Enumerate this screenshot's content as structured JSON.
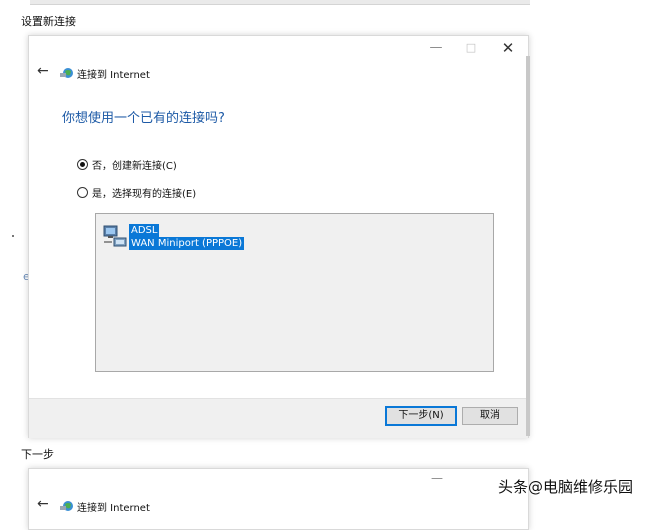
{
  "captions": {
    "step1": "设置新连接",
    "step2": "下一步"
  },
  "ghost_text": "e",
  "dialog": {
    "window_controls": {
      "minimize": "—",
      "maximize": "□",
      "close": "✕"
    },
    "back_glyph": "←",
    "breadcrumb": "连接到 Internet",
    "question": "你想使用一个已有的连接吗?",
    "options": [
      {
        "label": "否，创建新连接(C)",
        "selected": true
      },
      {
        "label": "是，选择现有的连接(E)",
        "selected": false
      }
    ],
    "connection": {
      "name": "ADSL",
      "device": "WAN Miniport (PPPOE)",
      "icon": "network-connection-icon"
    },
    "buttons": {
      "next": "下一步(N)",
      "cancel": "取消"
    }
  },
  "dialog2": {
    "minimize": "—",
    "back_glyph": "←",
    "breadcrumb": "连接到 Internet"
  },
  "watermark": {
    "text": "头条@电脑维修乐园"
  },
  "colors": {
    "accent": "#0a78d7",
    "heading": "#1d5aa6",
    "footer": "#f0f0f0"
  }
}
